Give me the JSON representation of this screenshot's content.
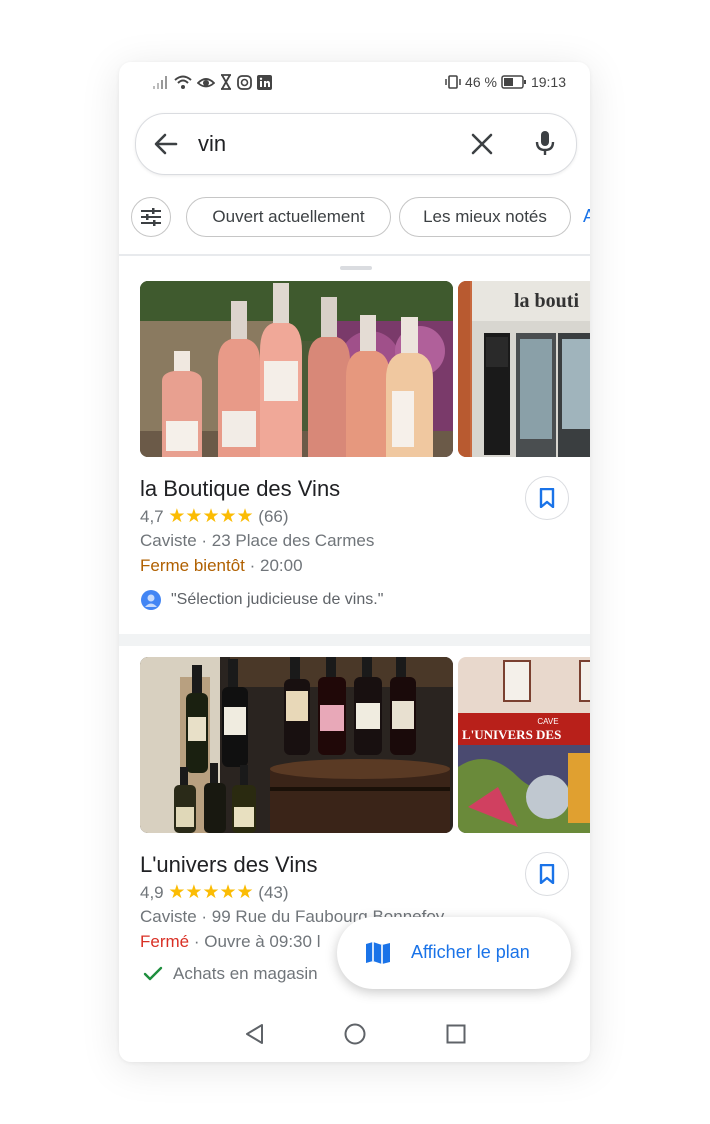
{
  "status_bar": {
    "battery_percent": "46 %",
    "time": "19:13",
    "left_icons": [
      "signal-icon",
      "wifi-icon",
      "eye-icon",
      "hourglass-icon",
      "instagram-icon",
      "linkedin-icon"
    ],
    "right_icons": [
      "vibrate-icon",
      "battery-icon"
    ]
  },
  "search": {
    "query": "vin",
    "back_icon": "arrow-left-icon",
    "clear_icon": "close-icon",
    "mic_icon": "microphone-icon"
  },
  "filters": {
    "filter_icon": "tune-icon",
    "chips": [
      "Ouvert actuellement",
      "Les mieux notés"
    ],
    "overflow_chip_letter": "A"
  },
  "results": [
    {
      "name": "la Boutique des Vins",
      "rating": "4,7",
      "stars": 4.7,
      "stars_text": "★★★★★",
      "reviews": "(66)",
      "category_address": "Caviste · 23 Place des Carmes",
      "status": "Ferme bientôt",
      "status_detail": " · 20:00",
      "review_snippet": "\"Sélection judicieuse de vins.\"",
      "photo_sign_text": "la bouti"
    },
    {
      "name": "L'univers des Vins",
      "rating": "4,9",
      "stars": 4.9,
      "stars_text": "★★★★★",
      "reviews": "(43)",
      "category_address": "Caviste · 99 Rue du Faubourg Bonnefoy",
      "status": "Fermé",
      "status_detail": " · Ouvre à 09:30 l",
      "feature": "Achats en magasin",
      "photo_sign_text": "L'UNIVERS DES",
      "photo_sign_small": "CAVE"
    }
  ],
  "map_button": {
    "label": "Afficher le plan",
    "icon": "map-icon"
  },
  "nav_bar": {
    "icons": [
      "back-triangle-icon",
      "home-circle-icon",
      "recents-square-icon"
    ]
  },
  "colors": {
    "accent": "#1a73e8",
    "star": "#fbbc04",
    "closing_soon": "#b06000",
    "closed": "#d93025",
    "check": "#1e8e3e"
  }
}
